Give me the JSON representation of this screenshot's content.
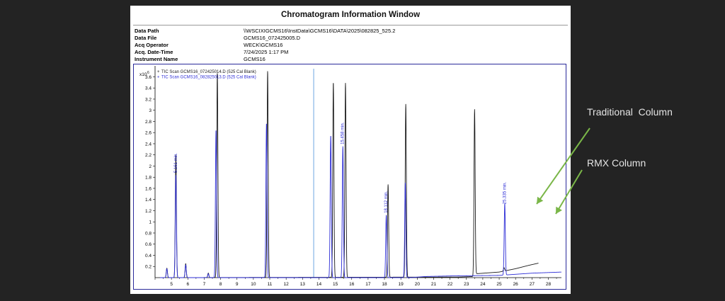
{
  "window": {
    "title": "Chromatogram Information Window"
  },
  "info": [
    {
      "label": "Data Path",
      "value": "\\\\WSCIXIGCMS16\\InstData\\GCMS16\\DATA\\2025\\082825_525.2"
    },
    {
      "label": "Data File",
      "value": "GCMS16_072425005.D"
    },
    {
      "label": "Acq Operator",
      "value": "WECK\\GCMS16"
    },
    {
      "label": "Acq. Date-Time",
      "value": "7/24/2025 1:17 PM"
    },
    {
      "label": "Instrument Name",
      "value": "GCMS16"
    }
  ],
  "annotations": {
    "traditional": "Traditional  Column",
    "rmx": "RMX Column"
  },
  "colors": {
    "traditional": "#1a1a1a",
    "rmx": "#2d2dd6",
    "annotation_arrow": "#7ab648",
    "frame": "#2a2a9a"
  },
  "chart_data": {
    "type": "line",
    "y_multiplier": "x10",
    "y_exponent": "6",
    "xlim": [
      4,
      28.8
    ],
    "ylim": [
      0,
      3.72
    ],
    "x_ticks": [
      5,
      6,
      7,
      8,
      9,
      10,
      11,
      12,
      13,
      14,
      15,
      16,
      17,
      18,
      19,
      20,
      21,
      22,
      23,
      24,
      25,
      26,
      27,
      28
    ],
    "y_ticks": [
      0.2,
      0.4,
      0.6,
      0.8,
      1,
      1.2,
      1.4,
      1.6,
      1.8,
      2,
      2.2,
      2.4,
      2.6,
      2.8,
      3,
      3.2,
      3.4,
      3.6
    ],
    "marker_line_x": 13.68,
    "series": [
      {
        "name": "TIC Scan GCMS16_072425014.D (525 Cal Blank)",
        "color": "#1a1a1a",
        "peaks": [
          [
            4.72,
            0.17
          ],
          [
            5.27,
            2.2
          ],
          [
            5.87,
            0.25
          ],
          [
            7.25,
            0.08
          ],
          [
            7.8,
            3.68
          ],
          [
            10.87,
            3.7
          ],
          [
            14.88,
            3.5
          ],
          [
            15.62,
            3.48
          ],
          [
            18.22,
            1.66
          ],
          [
            19.3,
            3.1
          ],
          [
            23.5,
            2.97
          ],
          [
            25.3,
            0.06
          ]
        ],
        "baseline": [
          [
            4.3,
            0.0
          ],
          [
            22.5,
            0.01
          ],
          [
            23.4,
            0.02
          ],
          [
            23.6,
            0.07
          ],
          [
            25.0,
            0.1
          ],
          [
            26.0,
            0.16
          ],
          [
            26.8,
            0.22
          ],
          [
            27.4,
            0.26
          ]
        ]
      },
      {
        "name": "TIC Scan GCMS16_082825013.D (525 Cal Blank)",
        "color": "#2d2dd6",
        "peaks": [
          [
            4.72,
            0.16
          ],
          [
            5.27,
            1.84
          ],
          [
            5.87,
            0.23
          ],
          [
            7.25,
            0.07
          ],
          [
            7.72,
            2.65
          ],
          [
            10.8,
            2.77
          ],
          [
            14.72,
            2.55
          ],
          [
            15.46,
            2.35
          ],
          [
            18.11,
            1.12
          ],
          [
            19.27,
            1.7
          ],
          [
            25.34,
            1.28
          ]
        ],
        "baseline": [
          [
            4.3,
            0.0
          ],
          [
            19.6,
            0.0
          ],
          [
            20.5,
            0.02
          ],
          [
            22.0,
            0.03
          ],
          [
            25.0,
            0.04
          ],
          [
            26.0,
            0.06
          ],
          [
            27.0,
            0.08
          ],
          [
            28.8,
            0.1
          ]
        ]
      }
    ],
    "peak_labels": [
      {
        "x": 5.27,
        "y": 1.84,
        "text": "5.161 min."
      },
      {
        "x": 15.46,
        "y": 2.35,
        "text": "15.458 min."
      },
      {
        "x": 18.11,
        "y": 1.12,
        "text": "18.112 min."
      },
      {
        "x": 25.34,
        "y": 1.28,
        "text": "25.335 min."
      }
    ]
  }
}
